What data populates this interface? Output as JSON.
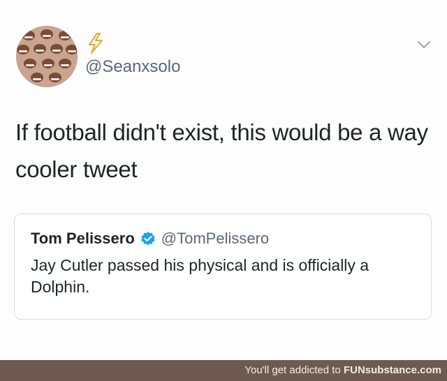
{
  "tweet": {
    "display_name": "⚡",
    "handle": "@Seanxsolo",
    "text": "If football didn't exist, this would be a way cooler tweet",
    "menu_icon": "chevron-down-icon",
    "avatar_icon": "avatar-image"
  },
  "quoted_tweet": {
    "name": "Tom Pelissero",
    "verified_icon": "verified-badge-icon",
    "handle": "@TomPelissero",
    "text": "Jay Cutler passed his physical and is officially a Dolphin."
  },
  "footer": {
    "text": "You'll get addicted to ",
    "brand": "FUNsubstance.com"
  },
  "colors": {
    "verified": "#1da1f2",
    "footer_bg": "#6e5a4e",
    "lightning": "#e8a92b"
  }
}
